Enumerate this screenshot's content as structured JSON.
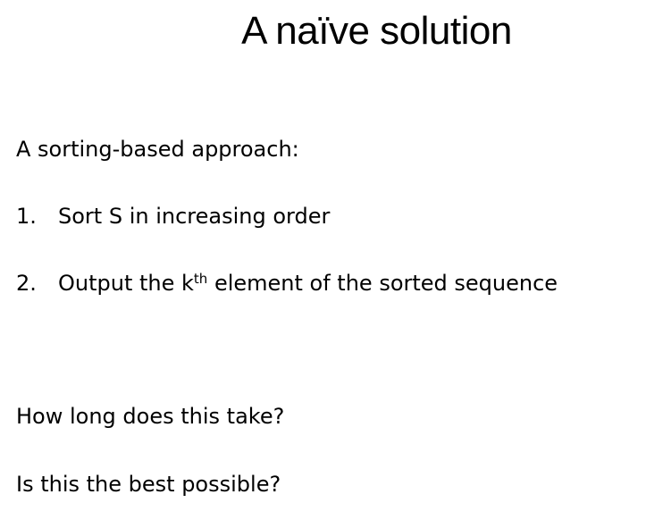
{
  "slide": {
    "title": "A naïve solution",
    "intro": "A sorting-based approach:",
    "steps": [
      {
        "number": "1.",
        "text": "Sort S in increasing order"
      },
      {
        "number": "2.",
        "text_before": "Output the k",
        "superscript": "th",
        "text_after": " element of the sorted sequence"
      }
    ],
    "questions": [
      "How long does this take?",
      "Is this the best possible?"
    ]
  }
}
